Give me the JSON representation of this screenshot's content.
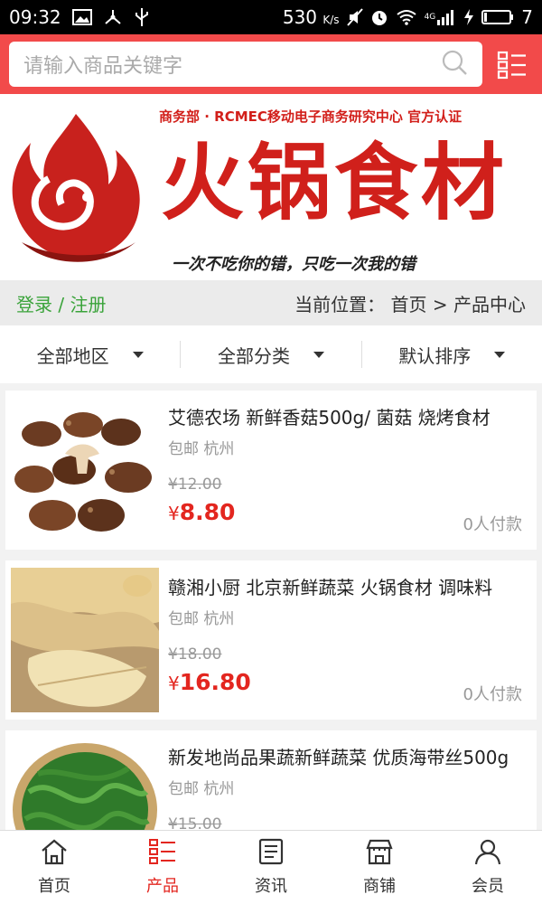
{
  "status_bar": {
    "time": "09:32",
    "net_speed": "530",
    "net_unit": "K/s",
    "signal_type": "4G",
    "battery": "7",
    "icons": [
      "image-icon",
      "usb-tether-icon",
      "usb-icon",
      "mute-icon",
      "alarm-icon",
      "wifi-icon",
      "signal-icon",
      "charging-icon",
      "battery-icon"
    ]
  },
  "search": {
    "placeholder": "请输入商品关键字",
    "icon": "search-icon",
    "menu_icon": "menu-icon"
  },
  "banner": {
    "certification": "商务部 · RCMEC移动电子商务研究中心 官方认证",
    "brand_name": "火锅食材",
    "slogan": "一次不吃你的错，只吃一次我的错",
    "logo": "flame-logo"
  },
  "crumb": {
    "login": "登录 / 注册",
    "location": "当前位置： 首页 > 产品中心"
  },
  "filters": [
    "全部地区",
    "全部分类",
    "默认排序"
  ],
  "products": [
    {
      "title": "艾德农场 新鲜香菇500g/ 菌菇 烧烤食材",
      "ship": "包邮 杭州",
      "old_price": "¥12.00",
      "price_symbol": "¥",
      "price": "8.80",
      "paid": "0人付款",
      "image": "shiitake-mushroom-image"
    },
    {
      "title": "赣湘小厨 北京新鲜蔬菜 火锅食材 调味料",
      "ship": "包邮 杭州",
      "old_price": "¥18.00",
      "price_symbol": "¥",
      "price": "16.80",
      "paid": "0人付款",
      "image": "ginger-image"
    },
    {
      "title": "新发地尚品果蔬新鲜蔬菜 优质海带丝500g",
      "ship": "包邮 杭州",
      "old_price": "¥15.00",
      "price_symbol": "¥",
      "price": "",
      "paid": "",
      "image": "kelp-image"
    }
  ],
  "tabbar": [
    {
      "label": "首页",
      "icon": "home-icon",
      "active": false
    },
    {
      "label": "产品",
      "icon": "list-icon",
      "active": true
    },
    {
      "label": "资讯",
      "icon": "news-icon",
      "active": false
    },
    {
      "label": "商铺",
      "icon": "shop-icon",
      "active": false
    },
    {
      "label": "会员",
      "icon": "user-icon",
      "active": false
    }
  ],
  "colors": {
    "header_red": "#f24a4a",
    "price_red": "#e3261f",
    "login_green": "#3aa33a"
  }
}
